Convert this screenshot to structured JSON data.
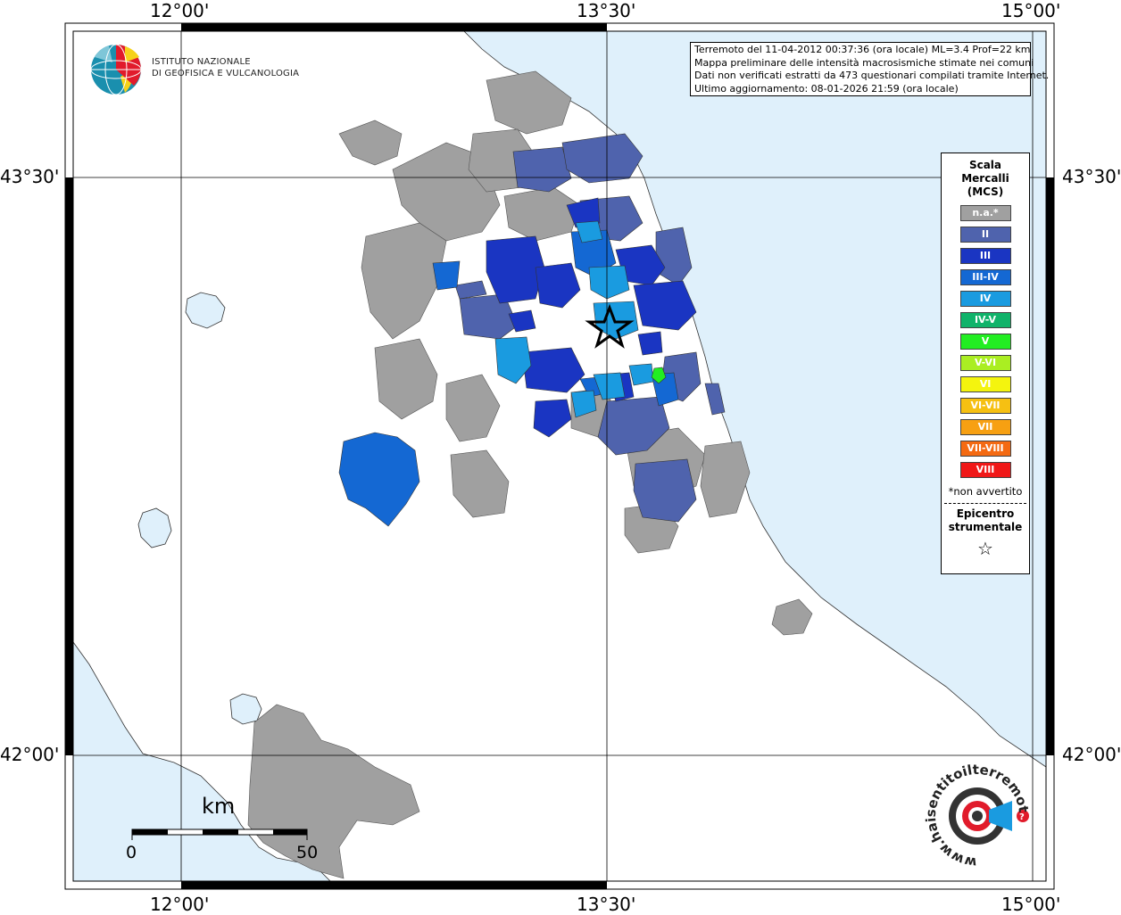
{
  "coordinates": {
    "top": [
      "12°00'",
      "13°30'",
      "15°00'"
    ],
    "bottom": [
      "12°00'",
      "13°30'",
      "15°00'"
    ],
    "left": [
      "43°30'",
      "42°00'"
    ],
    "right": [
      "43°30'",
      "42°00'"
    ]
  },
  "info_box": {
    "line1": "Terremoto del 11-04-2012 00:37:36 (ora locale) ML=3.4 Prof=22 km",
    "line2": "Mappa preliminare delle intensità macrosismiche stimate nei comuni",
    "line3": "Dati non verificati estratti da 473 questionari compilati tramite Internet.",
    "line4": "Ultimo aggiornamento: 08-01-2026 21:59 (ora locale)"
  },
  "logo_ingv": {
    "line1": "ISTITUTO NAZIONALE",
    "line2": "DI GEOFISICA E VULCANOLOGIA"
  },
  "legend": {
    "title1": "Scala",
    "title2": "Mercalli",
    "title3": "(MCS)",
    "items": [
      {
        "label": "n.a.*",
        "color": "#a0a0a0"
      },
      {
        "label": "II",
        "color": "#4f63ad"
      },
      {
        "label": "III",
        "color": "#1a35c2"
      },
      {
        "label": "III-IV",
        "color": "#1468d3"
      },
      {
        "label": "IV",
        "color": "#1a9be0"
      },
      {
        "label": "IV-V",
        "color": "#10b36a"
      },
      {
        "label": "V",
        "color": "#22ee22"
      },
      {
        "label": "V-VI",
        "color": "#aaee22"
      },
      {
        "label": "VI",
        "color": "#f4f40e"
      },
      {
        "label": "VI-VII",
        "color": "#f6c012"
      },
      {
        "label": "VII",
        "color": "#f7a012"
      },
      {
        "label": "VII-VIII",
        "color": "#f46a12"
      },
      {
        "label": "VIII",
        "color": "#f01818"
      }
    ],
    "note": "*non avvertito",
    "epi1": "Epicentro",
    "epi2": "strumentale",
    "star": "☆"
  },
  "scale_bar": {
    "unit": "km",
    "start": "0",
    "end": "50"
  },
  "logo_hsit": {
    "text": "www.haisentitoilterremoto.it"
  },
  "colors": {
    "sea": "#dff0fb",
    "na": "#a0a0a0",
    "ii": "#4f63ad",
    "iii": "#1a35c2",
    "iii_iv": "#1468d3",
    "iv": "#1a9be0",
    "v": "#22ee22"
  }
}
